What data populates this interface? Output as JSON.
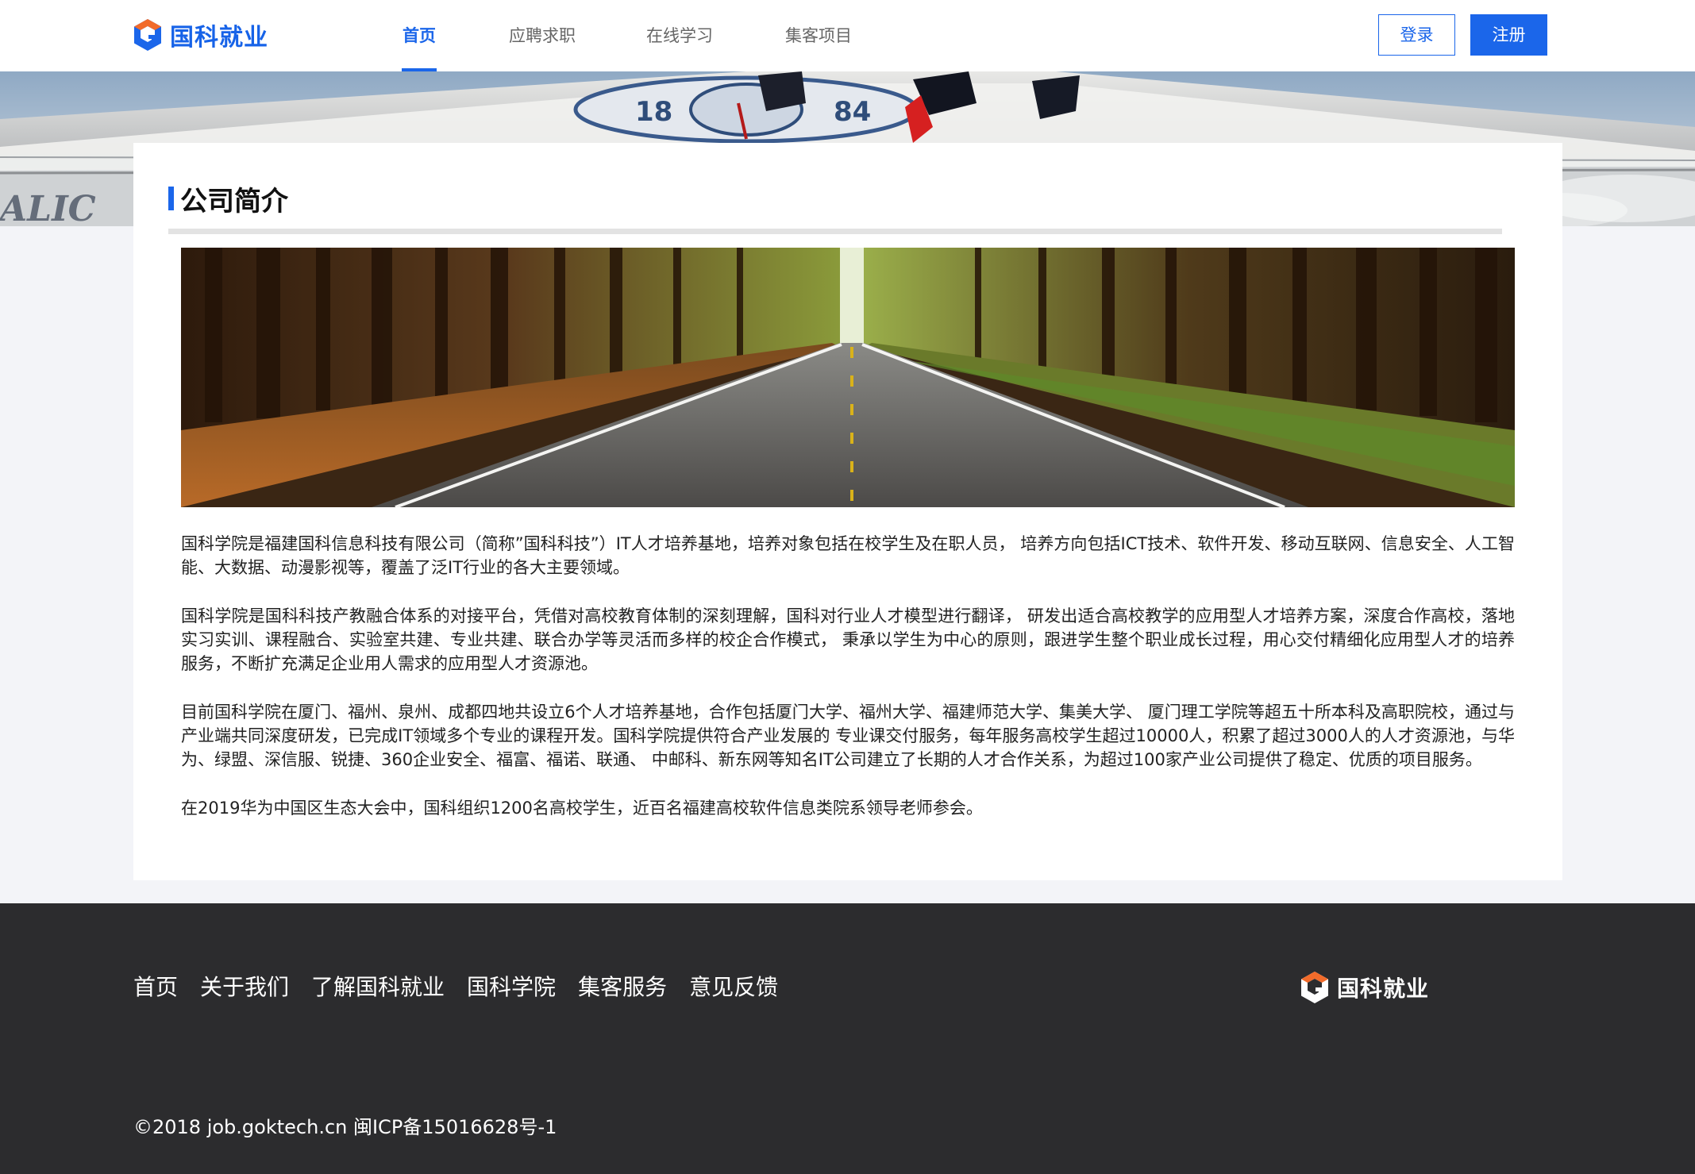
{
  "header": {
    "brand": "国科就业",
    "nav": [
      {
        "label": "首页",
        "active": true
      },
      {
        "label": "应聘求职",
        "active": false
      },
      {
        "label": "在线学习",
        "active": false
      },
      {
        "label": "集客项目",
        "active": false
      }
    ],
    "login_label": "登录",
    "register_label": "注册"
  },
  "banner": {
    "partial_text": "ALIC",
    "medallion_digits_left": "18",
    "medallion_digits_right": "84"
  },
  "main": {
    "section_title": "公司简介",
    "paragraphs": [
      "国科学院是福建国科信息科技有限公司（简称”国科科技”）IT人才培养基地，培养对象包括在校学生及在职人员， 培养方向包括ICT技术、软件开发、移动互联网、信息安全、人工智能、大数据、动漫影视等，覆盖了泛IT行业的各大主要领域。",
      "国科学院是国科科技产教融合体系的对接平台，凭借对高校教育体制的深刻理解，国科对行业人才模型进行翻译， 研发出适合高校教学的应用型人才培养方案，深度合作高校，落地实习实训、课程融合、实验室共建、专业共建、联合办学等灵活而多样的校企合作模式， 秉承以学生为中心的原则，跟进学生整个职业成长过程，用心交付精细化应用型人才的培养服务，不断扩充满足企业用人需求的应用型人才资源池。",
      "目前国科学院在厦门、福州、泉州、成都四地共设立6个人才培养基地，合作包括厦门大学、福州大学、福建师范大学、集美大学、 厦门理工学院等超五十所本科及高职院校，通过与产业端共同深度研发，已完成IT领域多个专业的课程开发。国科学院提供符合产业发展的 专业课交付服务，每年服务高校学生超过10000人，积累了超过3000人的人才资源池，与华为、绿盟、深信服、锐捷、360企业安全、福富、福诺、联通、 中邮科、新东网等知名IT公司建立了长期的人才合作关系，为超过100家产业公司提供了稳定、优质的项目服务。",
      "在2019华为中国区生态大会中，国科组织1200名高校学生，近百名福建高校软件信息类院系领导老师参会。"
    ]
  },
  "footer": {
    "links": [
      "首页",
      "关于我们",
      "了解国科就业",
      "国科学院",
      "集客服务",
      "意见反馈"
    ],
    "brand": "国科就业",
    "copyright": "©2018 job.goktech.cn 闽ICP备15016628号-1"
  },
  "colors": {
    "accent": "#1b66ea",
    "logo_orange": "#f26b2a",
    "footer_bg": "#2c2c2e",
    "page_bg": "#f3f4f8"
  }
}
